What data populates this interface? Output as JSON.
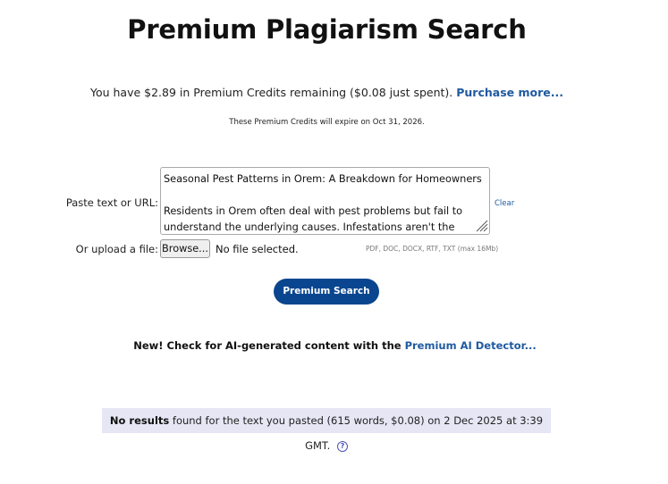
{
  "page_title": "Premium Plagiarism Search",
  "credits": {
    "text": "You have $2.89 in Premium Credits remaining ($0.08 just spent).",
    "purchase_link": "Purchase more..."
  },
  "expiry_note": "These Premium Credits will expire on Oct 31, 2026.",
  "form": {
    "paste_label": "Paste text or URL:",
    "textarea_value": "Seasonal Pest Patterns in Orem: A Breakdown for Homeowners\n\nResidents in Orem often deal with pest problems but fail to understand the underlying causes. Infestations aren't the same",
    "clear_link": "Clear",
    "upload_label": "Or upload a file:",
    "browse_button": "Browse...",
    "file_status": "No file selected.",
    "formats_hint": "PDF, DOC, DOCX, RTF, TXT (max 16Mb)",
    "search_button": "Premium Search"
  },
  "ai_promo": {
    "text": "New! Check for AI-generated content with the",
    "link": "Premium AI Detector..."
  },
  "result": {
    "bold": "No results",
    "text": "found for the text you pasted (615 words, $0.08) on 2 Dec 2025 at 3:39 GMT.",
    "help_icon": "?"
  },
  "colors": {
    "link": "#1f5aa0",
    "button": "#0a468f",
    "result_bg": "#e6e6f5"
  },
  "icons": [
    "resize-handle-icon",
    "help-circle-icon"
  ]
}
